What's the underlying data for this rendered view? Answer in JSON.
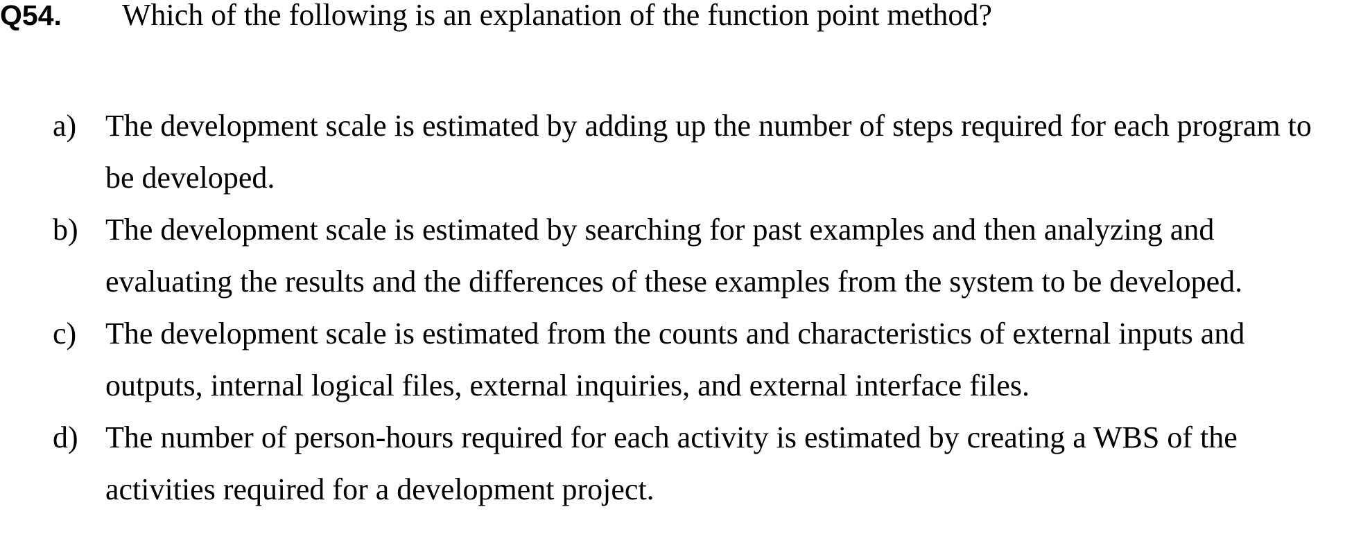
{
  "question": {
    "number": "Q54.",
    "text": "Which of the following is an explanation of the function point method?"
  },
  "options": [
    {
      "letter": "a)",
      "text": "The development scale is estimated by adding up the number of steps required for each program to be developed."
    },
    {
      "letter": "b)",
      "text": "The development scale is estimated by searching for past examples and then analyzing and evaluating the results and the differences of these examples from the system to be developed."
    },
    {
      "letter": "c)",
      "text": "The development scale is estimated from the counts and characteristics of external inputs and outputs, internal logical files, external inquiries, and external interface files."
    },
    {
      "letter": "d)",
      "text": "The number of person-hours required for each activity is estimated by creating a WBS of the activities required for a development project."
    }
  ]
}
